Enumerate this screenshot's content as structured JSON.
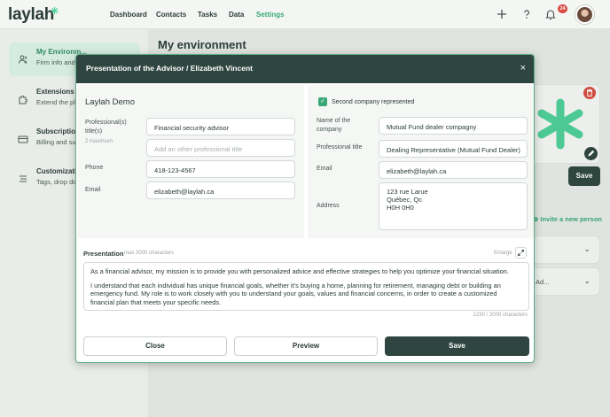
{
  "app": {
    "logo": "laylah",
    "logo_mark": "✳"
  },
  "nav": {
    "items": [
      {
        "label": "Dashboard"
      },
      {
        "label": "Contacts"
      },
      {
        "label": "Tasks"
      },
      {
        "label": "Data"
      },
      {
        "label": "Settings",
        "active": true
      }
    ]
  },
  "header_icons": {
    "add": "plus-icon",
    "help": "question-icon",
    "bell": "bell-icon",
    "notifications_count": "24"
  },
  "sidebar": {
    "items": [
      {
        "title": "My Environm...",
        "subtitle": "Firm info and",
        "icon": "users-icon",
        "active": true
      },
      {
        "title": "Extensions",
        "subtitle": "Extend the pla",
        "icon": "puzzle-icon"
      },
      {
        "title": "Subscription",
        "subtitle": "Billing and sub",
        "icon": "credit-card-icon"
      },
      {
        "title": "Customizatio",
        "subtitle": "Tags, drop dow",
        "icon": "list-icon"
      }
    ]
  },
  "main": {
    "title": "My environment",
    "save_label": "Save",
    "invite_label": "Invite a new person",
    "row2_text": "Ad..."
  },
  "modal": {
    "title": "Presentation of the Advisor / Elizabeth Vincent",
    "close_icon": "×",
    "left": {
      "section_title": "Laylah Demo",
      "professional_title_label": "Professional(s) title(s)",
      "professional_title_hint": "2 maximum",
      "professional_title_value": "Financial security advisor",
      "professional_title_placeholder": "Add an other professional title",
      "phone_label": "Phone",
      "phone_value": "418-123-4567",
      "email_label": "Email",
      "email_value": "elizabeth@laylah.ca"
    },
    "right": {
      "checkbox_label": "Second company represented",
      "checked": true,
      "company_label": "Name of the company",
      "company_value": "Mutual Fund dealer compagny",
      "title_label": "Professional title",
      "title_value": "Dealing Representative (Mutual Fund Dealer)",
      "email_label": "Email",
      "email_value": "elizabeth@laylah.ca",
      "address_label": "Address",
      "address_line1": "123 rue Larue",
      "address_line2": "Québec, Qc",
      "address_line3": "H0H 0H0"
    },
    "presentation": {
      "label": "Presentation",
      "max_hint": "max 2000 characters",
      "enlarge_label": "Enlarge",
      "paragraph1": "As a financial advisor, my mission is to provide you with personalized advice and effective strategies to help you optimize your financial situation.",
      "paragraph2": "I understand that each individual has unique financial goals, whether it's buying a home, planning for retirement, managing debt or building an emergency fund. My role is to work closely with you to understand your goals, values and financial concerns, in order to create a customized financial plan that meets your specific needs.",
      "counter": "1230 / 2000 characters"
    },
    "buttons": {
      "close": "Close",
      "preview": "Preview",
      "save": "Save"
    }
  },
  "colors": {
    "primary": "#2f4640",
    "accent": "#3aa876",
    "danger": "#d94c43"
  }
}
